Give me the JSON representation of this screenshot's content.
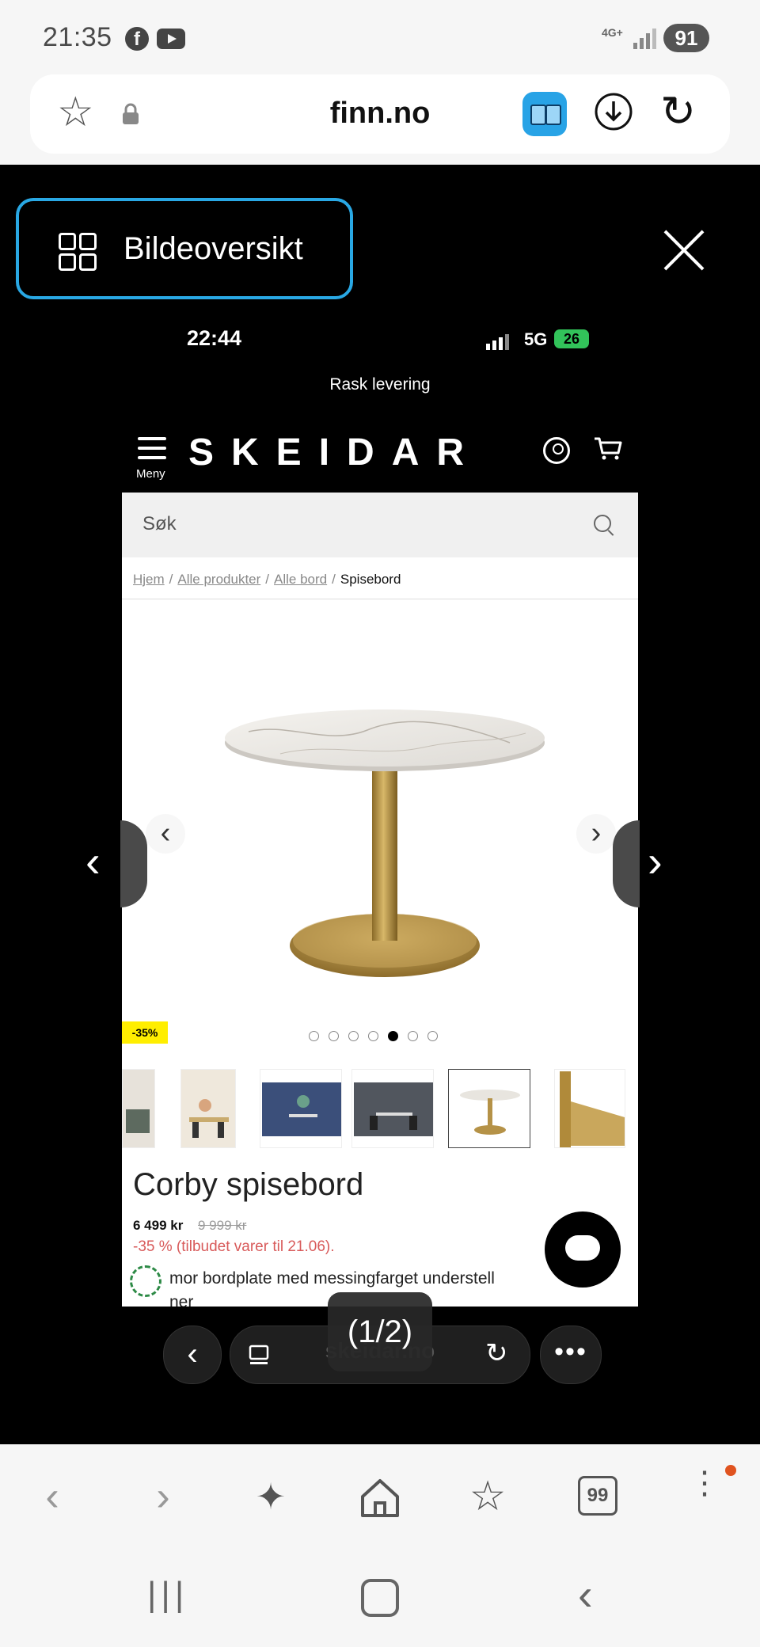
{
  "status_bar": {
    "time": "21:35",
    "network": "4G+",
    "battery": "91",
    "fb_icon": "f"
  },
  "browser": {
    "url": "finn.no"
  },
  "gallery": {
    "overview_label": "Bildeoversikt",
    "counter": "(1/2)"
  },
  "inner_phone": {
    "time": "22:44",
    "network": "5G",
    "battery": "26"
  },
  "site": {
    "promo_banner": "Rask levering",
    "menu_label": "Meny",
    "logo": "SKEIDAR",
    "search_placeholder": "Søk",
    "breadcrumbs": [
      "Hjem",
      "Alle produkter",
      "Alle bord"
    ],
    "breadcrumb_current": "Spisebord",
    "discount_badge": "-35%",
    "carousel": {
      "total": 7,
      "active_index": 4
    },
    "product": {
      "title": "Corby spisebord",
      "price": "6 499 kr",
      "old_price": "9 999 kr",
      "offer": "-35 % (tilbudet varer til 21.06).",
      "description_line1": "mor bordplate med messingfarget understell",
      "description_line2": "ner"
    },
    "inner_url": "skeidar.no"
  },
  "colors": {
    "accent": "#29a8e4",
    "offer": "#d85a5a",
    "badge": "#ffee00",
    "brass": "#b08a3a"
  },
  "toolbar_icons": [
    "back-icon",
    "forward-icon",
    "ai-sparkle-icon",
    "home-icon",
    "bookmarks-icon",
    "tabs-icon",
    "more-icon"
  ],
  "tabs_count": "99"
}
